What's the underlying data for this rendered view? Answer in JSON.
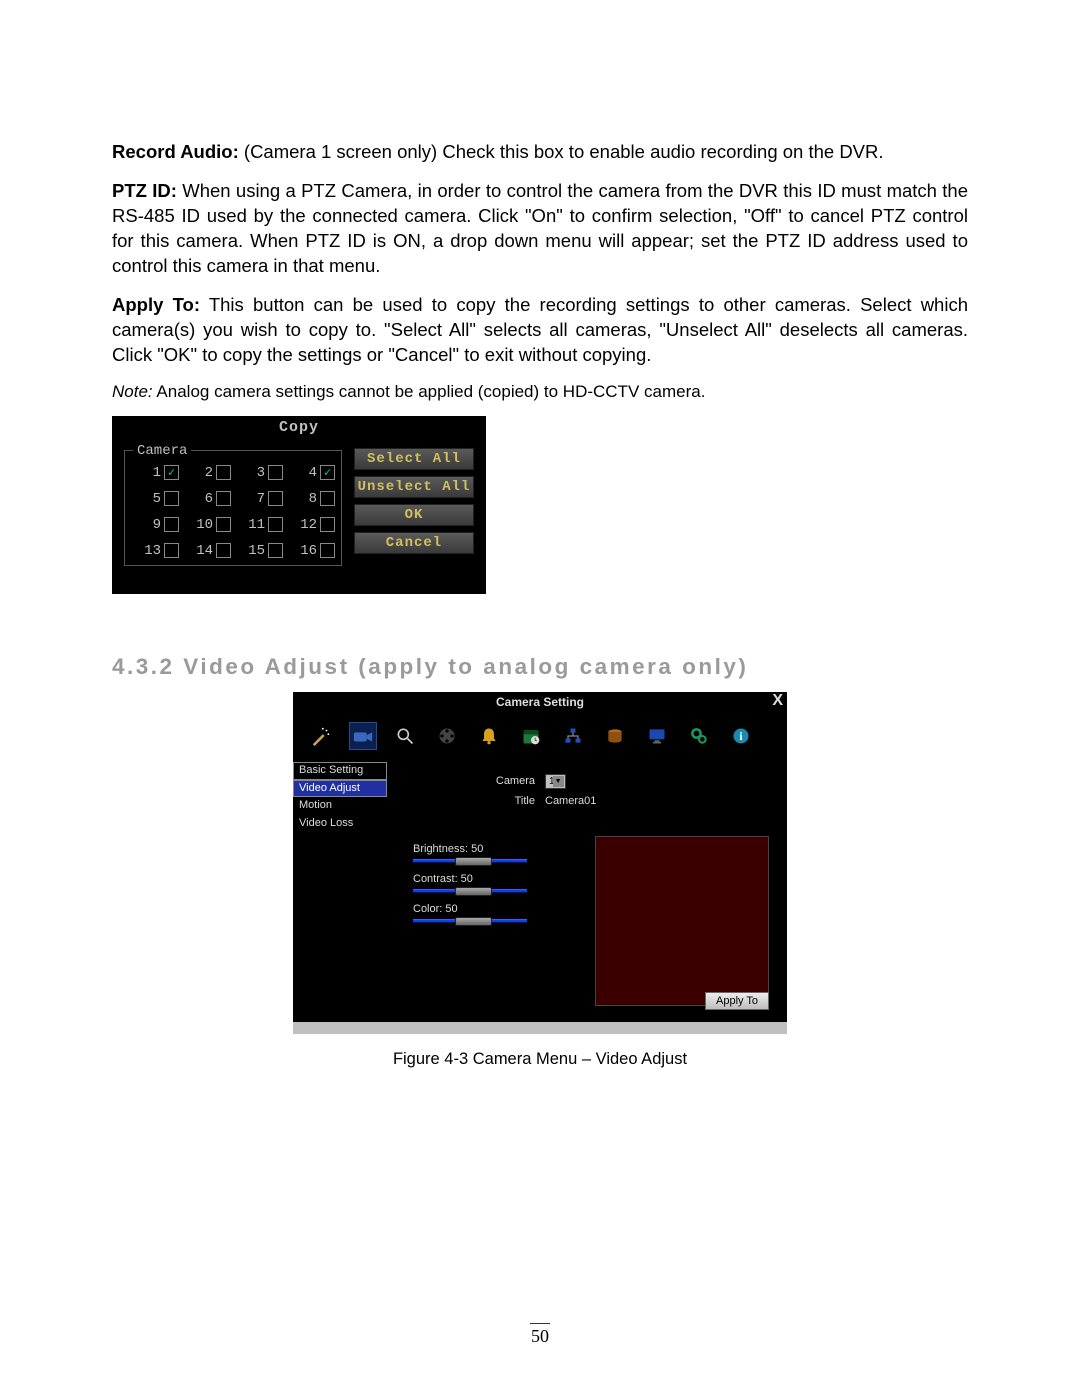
{
  "para1": {
    "bold": "Record Audio:",
    "rest": " (Camera 1 screen only) Check this box to enable audio recording on the DVR."
  },
  "para2": {
    "bold": "PTZ ID:",
    "rest": " When using a PTZ Camera, in order to control the camera from the DVR this ID must match the RS-485 ID used by the connected camera. Click \"On\" to confirm selection, \"Off\" to cancel PTZ control for this camera. When PTZ ID is ON, a drop down menu will appear; set the PTZ ID address used to control this camera in that menu."
  },
  "para3": {
    "bold": "Apply To:",
    "rest": " This button can be used to copy the recording settings to other cameras. Select which camera(s) you wish to copy to. \"Select All\" selects all cameras, \"Unselect All\" deselects all cameras. Click \"OK\" to copy the settings or \"Cancel\" to exit without copying."
  },
  "note": {
    "italic": "Note:",
    "rest": " Analog camera settings cannot be applied (copied) to HD-CCTV camera."
  },
  "copy_dialog": {
    "title": "Copy",
    "legend": "Camera",
    "cameras": [
      {
        "n": "1",
        "c": true
      },
      {
        "n": "2",
        "c": false
      },
      {
        "n": "3",
        "c": false
      },
      {
        "n": "4",
        "c": true
      },
      {
        "n": "5",
        "c": false
      },
      {
        "n": "6",
        "c": false
      },
      {
        "n": "7",
        "c": false
      },
      {
        "n": "8",
        "c": false
      },
      {
        "n": "9",
        "c": false
      },
      {
        "n": "10",
        "c": false
      },
      {
        "n": "11",
        "c": false
      },
      {
        "n": "12",
        "c": false
      },
      {
        "n": "13",
        "c": false
      },
      {
        "n": "14",
        "c": false
      },
      {
        "n": "15",
        "c": false
      },
      {
        "n": "16",
        "c": false
      }
    ],
    "buttons": {
      "select_all": "Select All",
      "unselect_all": "Unselect All",
      "ok": "OK",
      "cancel": "Cancel"
    }
  },
  "heading": "4.3.2 Video Adjust (apply to analog camera only)",
  "cam_dialog": {
    "title": "Camera Setting",
    "close": "X",
    "sidebar": [
      "Basic Setting",
      "Video Adjust",
      "Motion",
      "Video Loss"
    ],
    "camera_label": "Camera",
    "camera_value": "1",
    "title_label": "Title",
    "title_value": "Camera01",
    "sliders": [
      {
        "label": "Brightness: 50",
        "pos": 42
      },
      {
        "label": "Contrast: 50",
        "pos": 42
      },
      {
        "label": "Color: 50",
        "pos": 42
      }
    ],
    "apply_to": "Apply To"
  },
  "figure_caption": "Figure 4-3  Camera Menu – Video Adjust",
  "page_number": "50"
}
